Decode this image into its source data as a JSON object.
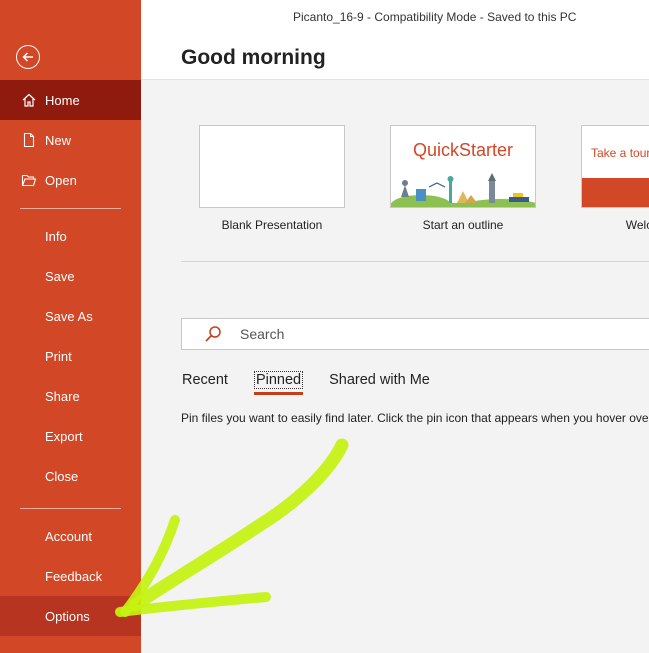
{
  "sidebar": {
    "items": [
      {
        "label": "Home"
      },
      {
        "label": "New"
      },
      {
        "label": "Open"
      },
      {
        "label": "Info"
      },
      {
        "label": "Save"
      },
      {
        "label": "Save As"
      },
      {
        "label": "Print"
      },
      {
        "label": "Share"
      },
      {
        "label": "Export"
      },
      {
        "label": "Close"
      },
      {
        "label": "Account"
      },
      {
        "label": "Feedback"
      },
      {
        "label": "Options"
      }
    ],
    "active": "Home",
    "highlighted": "Options",
    "icons": {
      "back": "back-arrow-icon",
      "home": "home-icon",
      "new": "new-document-icon",
      "open": "open-folder-icon"
    }
  },
  "titlebar": {
    "text": "Picanto_16-9  -  Compatibility Mode  -  Saved to this PC"
  },
  "main": {
    "greeting": "Good morning",
    "templates": [
      {
        "caption": "Blank Presentation"
      },
      {
        "caption": "Start an outline",
        "thumb_title": "QuickStarter"
      },
      {
        "caption": "Welcome t",
        "thumb_text": "Take a tour"
      }
    ],
    "search": {
      "placeholder": "Search"
    },
    "tabs": [
      {
        "label": "Recent"
      },
      {
        "label": "Pinned"
      },
      {
        "label": "Shared with Me"
      }
    ],
    "active_tab": "Pinned",
    "pinned_message": "Pin files you want to easily find later. Click the pin icon that appears when you hover over"
  },
  "colors": {
    "brand": "#d24726",
    "active_nav": "#8f1b0e",
    "annotation": "#c6f211"
  }
}
